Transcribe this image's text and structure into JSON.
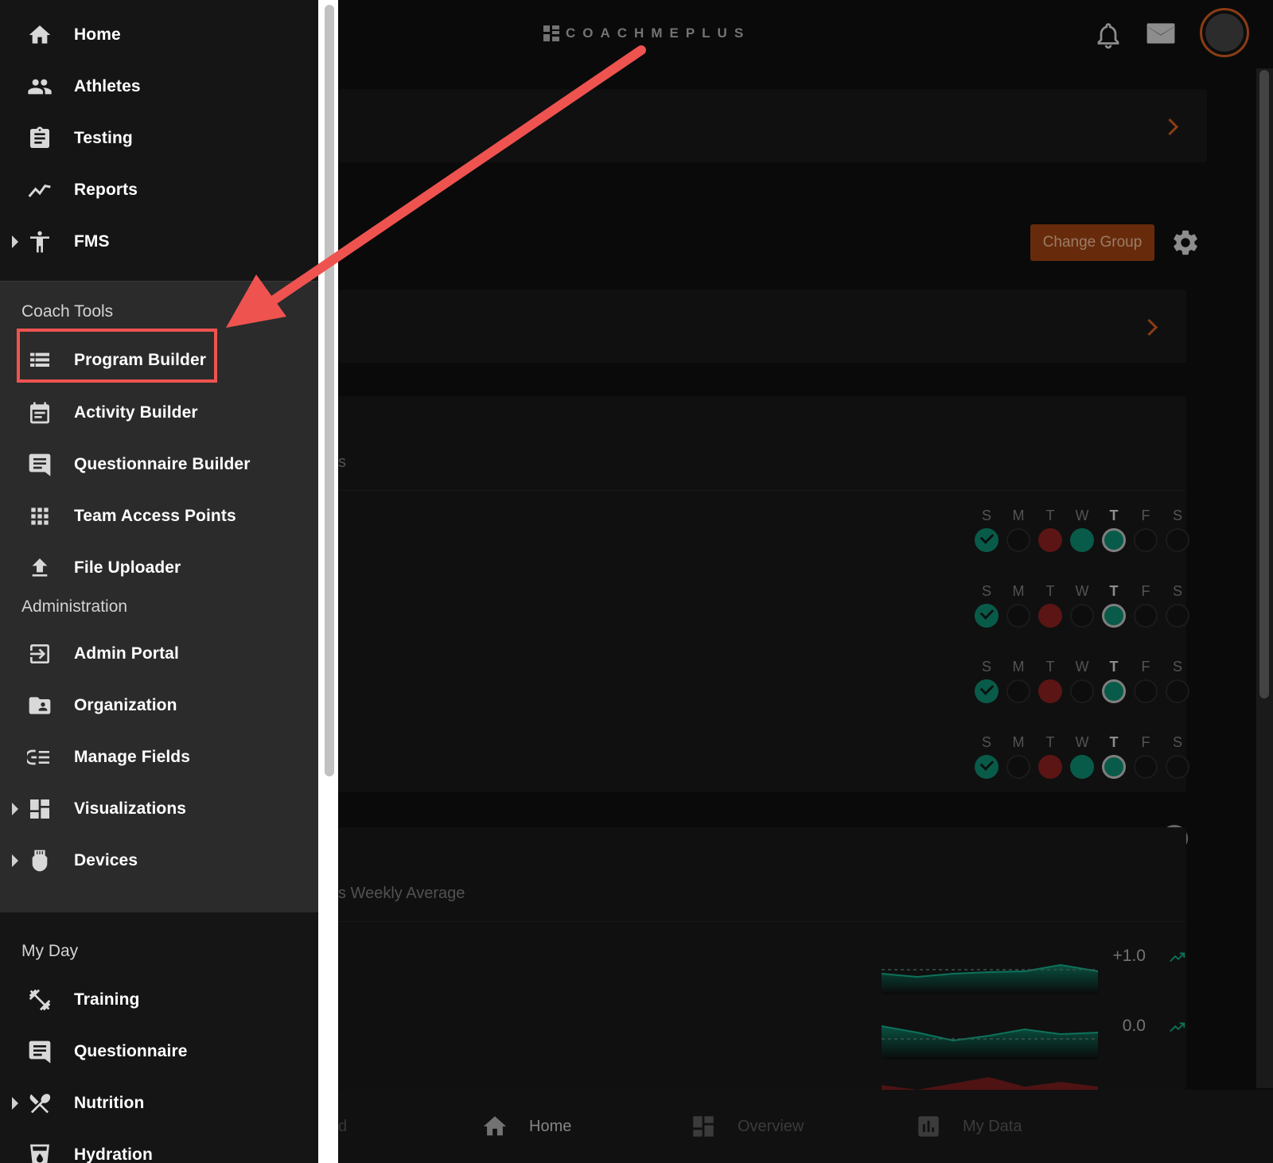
{
  "drawer": {
    "top_items": [
      {
        "label": "Home",
        "icon": "home-icon"
      },
      {
        "label": "Athletes",
        "icon": "people-icon"
      },
      {
        "label": "Testing",
        "icon": "clipboard-icon"
      },
      {
        "label": "Reports",
        "icon": "line-chart-icon"
      },
      {
        "label": "FMS",
        "icon": "accessibility-icon"
      }
    ],
    "coach_tools": {
      "title": "Coach Tools",
      "items": [
        {
          "label": "Program Builder",
          "icon": "list-icon"
        },
        {
          "label": "Activity Builder",
          "icon": "calendar-note-icon"
        },
        {
          "label": "Questionnaire Builder",
          "icon": "chat-icon"
        },
        {
          "label": "Team Access Points",
          "icon": "grid-icon"
        },
        {
          "label": "File Uploader",
          "icon": "upload-icon"
        }
      ]
    },
    "administration": {
      "title": "Administration",
      "items": [
        {
          "label": "Admin Portal",
          "icon": "login-icon"
        },
        {
          "label": "Organization",
          "icon": "folder-person-icon"
        },
        {
          "label": "Manage Fields",
          "icon": "fields-icon"
        },
        {
          "label": "Visualizations",
          "icon": "dashboard-icon"
        },
        {
          "label": "Devices",
          "icon": "device-icon"
        }
      ]
    },
    "my_day": {
      "title": "My Day",
      "items": [
        {
          "label": "Training",
          "icon": "dumbbell-icon"
        },
        {
          "label": "Questionnaire",
          "icon": "chat-icon"
        },
        {
          "label": "Nutrition",
          "icon": "utensils-icon"
        },
        {
          "label": "Hydration",
          "icon": "cup-icon"
        }
      ]
    }
  },
  "header": {
    "logo_text": "COACHMEPLUS"
  },
  "main": {
    "change_group_label": "Change Group",
    "help_label": "?",
    "partial_text_1": "s",
    "partial_text_2": "s Weekly Average",
    "day_letters": [
      "S",
      "M",
      "T",
      "W",
      "T",
      "F",
      "S"
    ],
    "weeks": [
      [
        "check",
        "empty",
        "red",
        "green",
        "today",
        "empty",
        "empty"
      ],
      [
        "check",
        "empty",
        "red",
        "empty",
        "today",
        "empty",
        "empty"
      ],
      [
        "check",
        "empty",
        "red",
        "empty",
        "today",
        "empty",
        "empty"
      ],
      [
        "check",
        "empty",
        "red",
        "green",
        "today",
        "empty",
        "empty"
      ]
    ],
    "trend_values": [
      "+1.0",
      "0.0"
    ]
  },
  "bottom_nav": {
    "partial_label": "d",
    "items": [
      {
        "label": "Home",
        "icon": "home-icon"
      },
      {
        "label": "Overview",
        "icon": "dashboard-icon"
      },
      {
        "label": "My Data",
        "icon": "bar-chart-icon"
      }
    ]
  },
  "colors": {
    "accent": "#b8511d",
    "highlight": "#ef5350",
    "green": "#0c7a62",
    "red": "#7a1c1c"
  }
}
